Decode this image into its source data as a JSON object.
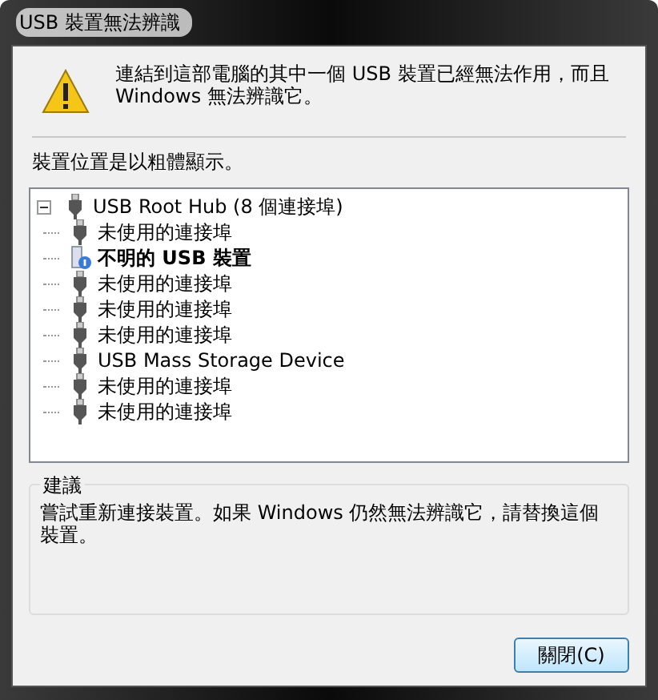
{
  "window": {
    "title": "USB 裝置無法辨識"
  },
  "message": "連結到這部電腦的其中一個 USB 裝置已經無法作用，而且 Windows 無法辨識它。",
  "hint": "裝置位置是以粗體顯示。",
  "tree": [
    {
      "label": "USB Root Hub (8 個連接埠)",
      "kind": "hub",
      "bold": false,
      "expanded": true,
      "children": [
        {
          "label": "未使用的連接埠",
          "kind": "port",
          "bold": false
        },
        {
          "label": "不明的 USB 裝置",
          "kind": "unknown",
          "bold": true
        },
        {
          "label": "未使用的連接埠",
          "kind": "port",
          "bold": false
        },
        {
          "label": "未使用的連接埠",
          "kind": "port",
          "bold": false
        },
        {
          "label": "未使用的連接埠",
          "kind": "port",
          "bold": false
        },
        {
          "label": "USB Mass Storage Device",
          "kind": "port",
          "bold": false
        },
        {
          "label": "未使用的連接埠",
          "kind": "port",
          "bold": false
        },
        {
          "label": "未使用的連接埠",
          "kind": "port",
          "bold": false
        }
      ]
    }
  ],
  "suggestion": {
    "title": "建議",
    "text": "嘗試重新連接裝置。如果 Windows 仍然無法辨識它，請替換這個裝置。"
  },
  "buttons": [
    "關閉(C)"
  ]
}
